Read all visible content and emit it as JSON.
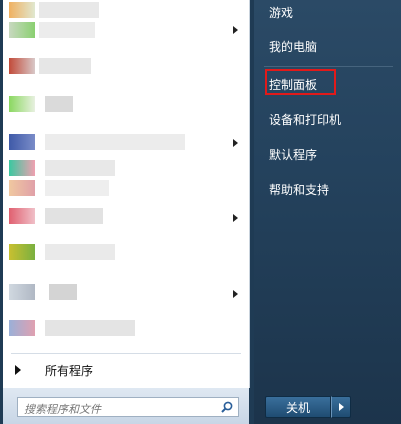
{
  "right_menu": {
    "items": [
      {
        "label": "游戏"
      },
      {
        "label": "我的电脑"
      },
      {
        "label": "控制面板"
      },
      {
        "label": "设备和打印机"
      },
      {
        "label": "默认程序"
      },
      {
        "label": "帮助和支持"
      }
    ],
    "highlight_color": "#e21a1a"
  },
  "left_menu": {
    "all_programs_label": "所有程序"
  },
  "search": {
    "placeholder": "搜索程序和文件"
  },
  "shutdown": {
    "label": "关机"
  }
}
